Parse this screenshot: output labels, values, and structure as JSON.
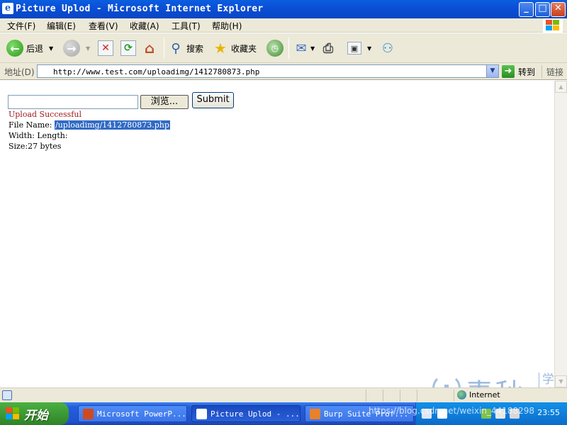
{
  "window": {
    "title": "Picture Uplod - Microsoft Internet Explorer",
    "app_icon_glyph": "e",
    "buttons": {
      "minimize": "_",
      "maximize": "□",
      "close": "✕"
    }
  },
  "menu": {
    "items": [
      "文件(F)",
      "编辑(E)",
      "查看(V)",
      "收藏(A)",
      "工具(T)",
      "帮助(H)"
    ]
  },
  "toolbar": {
    "back_label": "后退",
    "search_label": "搜索",
    "favorites_label": "收藏夹",
    "icons": [
      "back-icon",
      "forward-icon",
      "stop-icon",
      "refresh-icon",
      "home-icon",
      "search-icon",
      "favorites-icon",
      "history-icon",
      "mail-icon",
      "print-icon",
      "edit-icon",
      "messenger-icon"
    ]
  },
  "address": {
    "label": "地址(D)",
    "url": "http://www.test.com/uploadimg/1412780873.php",
    "go_label": "转到",
    "links_label": "链接"
  },
  "page": {
    "browse_label": "浏览...",
    "submit_label": "Submit",
    "status_message": "Upload Successful",
    "file_name_label": "File Name:",
    "file_name_value": "/uploadimg/1412780873.php",
    "width_length": "Width: Length:",
    "size": "Size:27 bytes"
  },
  "statusbar": {
    "zone": "Internet"
  },
  "taskbar": {
    "start_label": "开始",
    "tasks": [
      {
        "label": "Microsoft PowerP...",
        "active": false
      },
      {
        "label": "Picture Uplod - ...",
        "active": true
      },
      {
        "label": "Burp Suite Prof...",
        "active": false
      }
    ],
    "clock": "23:55"
  },
  "watermark": {
    "name": "青秋",
    "side": "学院",
    "url": "https://blog.csdn.net/weixin_44188298"
  },
  "colors": {
    "titlebar": "#0b4fd6",
    "success_text": "#a01818",
    "selection": "#316ac5",
    "taskbar": "#245edb",
    "start_button": "#3c9a34"
  }
}
